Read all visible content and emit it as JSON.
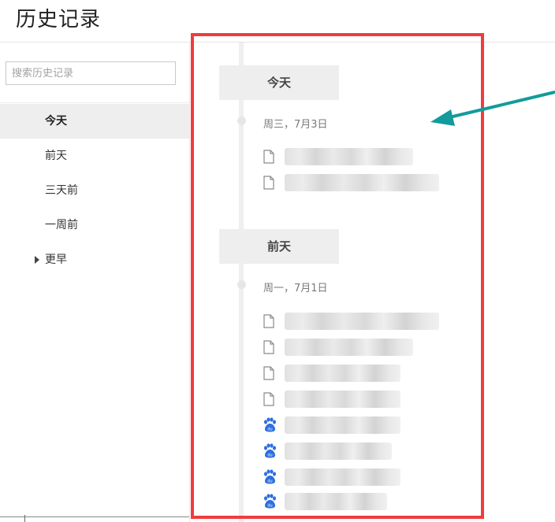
{
  "page": {
    "title": "历史记录"
  },
  "search": {
    "placeholder": "搜索历史记录",
    "value": ""
  },
  "sidebar": {
    "items": [
      {
        "label": "今天",
        "active": true
      },
      {
        "label": "前天",
        "active": false
      },
      {
        "label": "三天前",
        "active": false
      },
      {
        "label": "一周前",
        "active": false
      },
      {
        "label": "更早",
        "active": false,
        "expandable": true
      }
    ]
  },
  "history": {
    "groups": [
      {
        "header": "今天",
        "date": "周三，7月3日",
        "entries": [
          {
            "icon": "page-icon",
            "title": ""
          },
          {
            "icon": "page-icon",
            "title": ""
          }
        ]
      },
      {
        "header": "前天",
        "date": "周一，7月1日",
        "entries": [
          {
            "icon": "page-icon",
            "title": ""
          },
          {
            "icon": "page-icon",
            "title": ""
          },
          {
            "icon": "page-icon",
            "title": ""
          },
          {
            "icon": "page-icon",
            "title": ""
          },
          {
            "icon": "baidu-icon",
            "title": ""
          },
          {
            "icon": "baidu-icon",
            "title": ""
          },
          {
            "icon": "baidu-icon",
            "title": ""
          },
          {
            "icon": "baidu-icon",
            "title": ""
          }
        ]
      }
    ]
  },
  "colors": {
    "annotation_box": "#f03c3c",
    "annotation_arrow": "#139b9b",
    "baidu_blue": "#2d6ee0",
    "active_item_bg": "#eeeeee"
  }
}
